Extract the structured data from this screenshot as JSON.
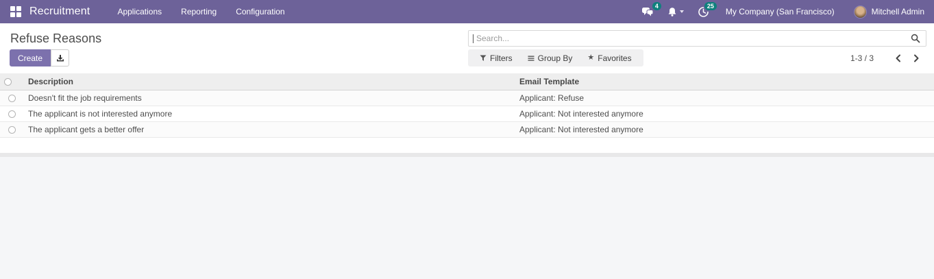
{
  "navbar": {
    "app_name": "Recruitment",
    "menus": [
      "Applications",
      "Reporting",
      "Configuration"
    ],
    "messages_badge": "4",
    "activities_badge": "25",
    "company": "My Company (San Francisco)",
    "user": "Mitchell Admin"
  },
  "control_panel": {
    "title": "Refuse Reasons",
    "search": {
      "placeholder": "Search..."
    },
    "buttons": {
      "create": "Create"
    },
    "filters": {
      "filters": "Filters",
      "group_by": "Group By",
      "favorites": "Favorites"
    },
    "pager": {
      "range": "1-3 / 3"
    }
  },
  "table": {
    "columns": [
      "Description",
      "Email Template"
    ],
    "rows": [
      {
        "description": "Doesn't fit the job requirements",
        "email_template": "Applicant: Refuse"
      },
      {
        "description": "The applicant is not interested anymore",
        "email_template": "Applicant: Not interested anymore"
      },
      {
        "description": "The applicant gets a better offer",
        "email_template": "Applicant: Not interested anymore"
      }
    ]
  },
  "colors": {
    "navbar_background": "#6d6299",
    "primary_button": "#7c71ad",
    "badge": "#0f807d",
    "table_header_background": "#eeeeee"
  }
}
